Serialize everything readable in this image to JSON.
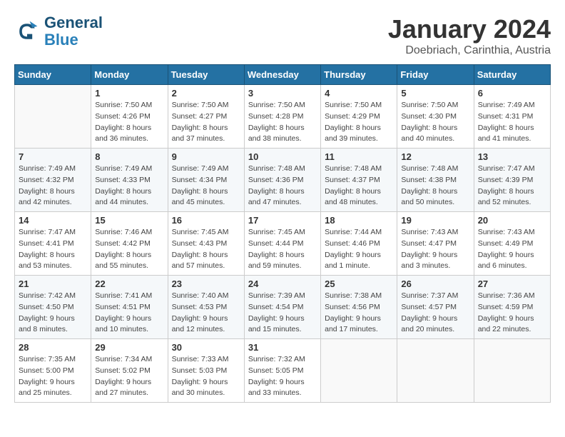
{
  "header": {
    "logo_line1": "General",
    "logo_line2": "Blue",
    "title": "January 2024",
    "subtitle": "Doebriach, Carinthia, Austria"
  },
  "calendar": {
    "days_of_week": [
      "Sunday",
      "Monday",
      "Tuesday",
      "Wednesday",
      "Thursday",
      "Friday",
      "Saturday"
    ],
    "weeks": [
      [
        {
          "day": "",
          "sunrise": "",
          "sunset": "",
          "daylight": ""
        },
        {
          "day": "1",
          "sunrise": "7:50 AM",
          "sunset": "4:26 PM",
          "daylight": "8 hours and 36 minutes."
        },
        {
          "day": "2",
          "sunrise": "7:50 AM",
          "sunset": "4:27 PM",
          "daylight": "8 hours and 37 minutes."
        },
        {
          "day": "3",
          "sunrise": "7:50 AM",
          "sunset": "4:28 PM",
          "daylight": "8 hours and 38 minutes."
        },
        {
          "day": "4",
          "sunrise": "7:50 AM",
          "sunset": "4:29 PM",
          "daylight": "8 hours and 39 minutes."
        },
        {
          "day": "5",
          "sunrise": "7:50 AM",
          "sunset": "4:30 PM",
          "daylight": "8 hours and 40 minutes."
        },
        {
          "day": "6",
          "sunrise": "7:49 AM",
          "sunset": "4:31 PM",
          "daylight": "8 hours and 41 minutes."
        }
      ],
      [
        {
          "day": "7",
          "sunrise": "7:49 AM",
          "sunset": "4:32 PM",
          "daylight": "8 hours and 42 minutes."
        },
        {
          "day": "8",
          "sunrise": "7:49 AM",
          "sunset": "4:33 PM",
          "daylight": "8 hours and 44 minutes."
        },
        {
          "day": "9",
          "sunrise": "7:49 AM",
          "sunset": "4:34 PM",
          "daylight": "8 hours and 45 minutes."
        },
        {
          "day": "10",
          "sunrise": "7:48 AM",
          "sunset": "4:36 PM",
          "daylight": "8 hours and 47 minutes."
        },
        {
          "day": "11",
          "sunrise": "7:48 AM",
          "sunset": "4:37 PM",
          "daylight": "8 hours and 48 minutes."
        },
        {
          "day": "12",
          "sunrise": "7:48 AM",
          "sunset": "4:38 PM",
          "daylight": "8 hours and 50 minutes."
        },
        {
          "day": "13",
          "sunrise": "7:47 AM",
          "sunset": "4:39 PM",
          "daylight": "8 hours and 52 minutes."
        }
      ],
      [
        {
          "day": "14",
          "sunrise": "7:47 AM",
          "sunset": "4:41 PM",
          "daylight": "8 hours and 53 minutes."
        },
        {
          "day": "15",
          "sunrise": "7:46 AM",
          "sunset": "4:42 PM",
          "daylight": "8 hours and 55 minutes."
        },
        {
          "day": "16",
          "sunrise": "7:45 AM",
          "sunset": "4:43 PM",
          "daylight": "8 hours and 57 minutes."
        },
        {
          "day": "17",
          "sunrise": "7:45 AM",
          "sunset": "4:44 PM",
          "daylight": "8 hours and 59 minutes."
        },
        {
          "day": "18",
          "sunrise": "7:44 AM",
          "sunset": "4:46 PM",
          "daylight": "9 hours and 1 minute."
        },
        {
          "day": "19",
          "sunrise": "7:43 AM",
          "sunset": "4:47 PM",
          "daylight": "9 hours and 3 minutes."
        },
        {
          "day": "20",
          "sunrise": "7:43 AM",
          "sunset": "4:49 PM",
          "daylight": "9 hours and 6 minutes."
        }
      ],
      [
        {
          "day": "21",
          "sunrise": "7:42 AM",
          "sunset": "4:50 PM",
          "daylight": "9 hours and 8 minutes."
        },
        {
          "day": "22",
          "sunrise": "7:41 AM",
          "sunset": "4:51 PM",
          "daylight": "9 hours and 10 minutes."
        },
        {
          "day": "23",
          "sunrise": "7:40 AM",
          "sunset": "4:53 PM",
          "daylight": "9 hours and 12 minutes."
        },
        {
          "day": "24",
          "sunrise": "7:39 AM",
          "sunset": "4:54 PM",
          "daylight": "9 hours and 15 minutes."
        },
        {
          "day": "25",
          "sunrise": "7:38 AM",
          "sunset": "4:56 PM",
          "daylight": "9 hours and 17 minutes."
        },
        {
          "day": "26",
          "sunrise": "7:37 AM",
          "sunset": "4:57 PM",
          "daylight": "9 hours and 20 minutes."
        },
        {
          "day": "27",
          "sunrise": "7:36 AM",
          "sunset": "4:59 PM",
          "daylight": "9 hours and 22 minutes."
        }
      ],
      [
        {
          "day": "28",
          "sunrise": "7:35 AM",
          "sunset": "5:00 PM",
          "daylight": "9 hours and 25 minutes."
        },
        {
          "day": "29",
          "sunrise": "7:34 AM",
          "sunset": "5:02 PM",
          "daylight": "9 hours and 27 minutes."
        },
        {
          "day": "30",
          "sunrise": "7:33 AM",
          "sunset": "5:03 PM",
          "daylight": "9 hours and 30 minutes."
        },
        {
          "day": "31",
          "sunrise": "7:32 AM",
          "sunset": "5:05 PM",
          "daylight": "9 hours and 33 minutes."
        },
        {
          "day": "",
          "sunrise": "",
          "sunset": "",
          "daylight": ""
        },
        {
          "day": "",
          "sunrise": "",
          "sunset": "",
          "daylight": ""
        },
        {
          "day": "",
          "sunrise": "",
          "sunset": "",
          "daylight": ""
        }
      ]
    ]
  }
}
